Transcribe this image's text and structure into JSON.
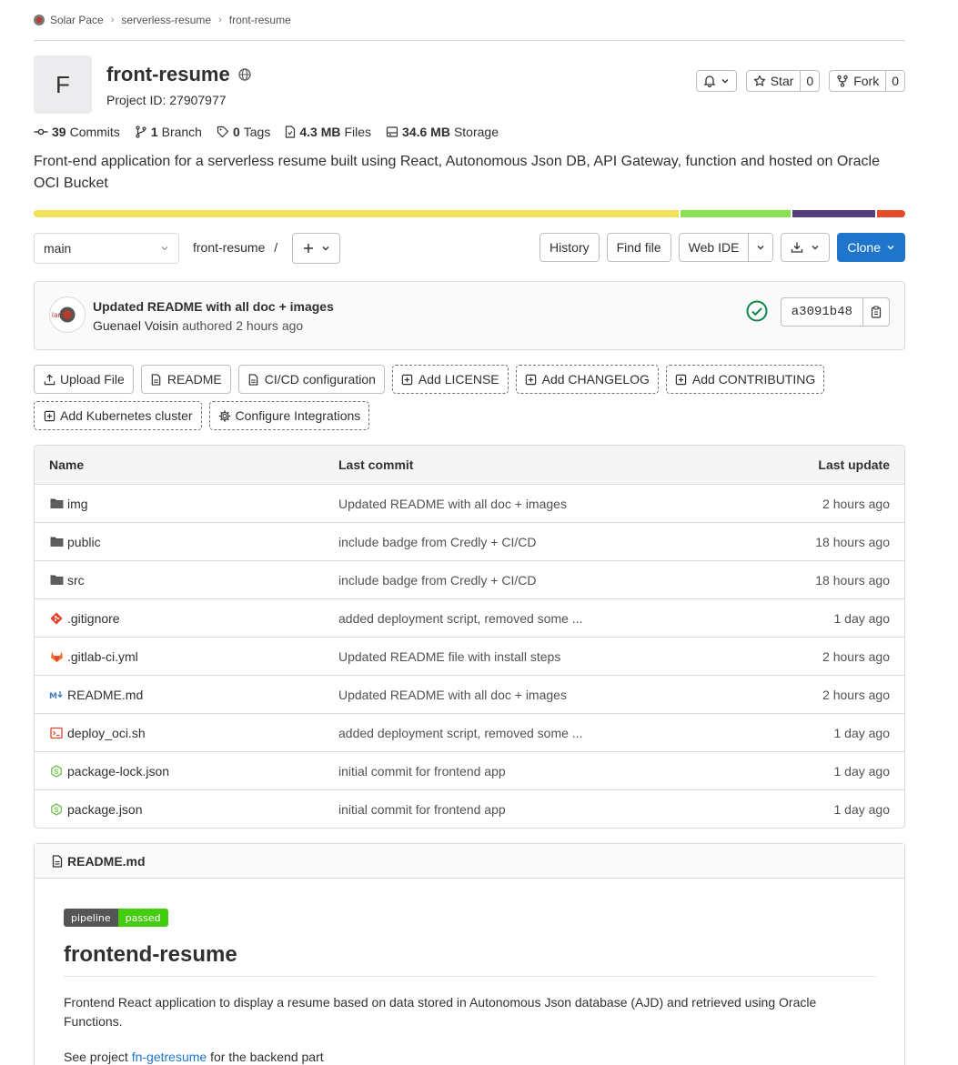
{
  "breadcrumb": [
    "Solar Pace",
    "serverless-resume",
    "front-resume"
  ],
  "project": {
    "avatar_letter": "F",
    "name": "front-resume",
    "id_label": "Project ID: 27907977",
    "star_label": "Star",
    "star_count": "0",
    "fork_label": "Fork",
    "fork_count": "0"
  },
  "stats": {
    "commits_count": "39",
    "commits_label": "Commits",
    "branch_count": "1",
    "branch_label": "Branch",
    "tags_count": "0",
    "tags_label": "Tags",
    "files_size": "4.3 MB",
    "files_label": "Files",
    "storage_size": "34.6 MB",
    "storage_label": "Storage"
  },
  "description": "Front-end application for a serverless resume built using React, Autonomous Json DB, API Gateway, function and hosted on Oracle OCI Bucket",
  "languages": [
    {
      "color": "#f1e05a",
      "percent": 74.5
    },
    {
      "color": "#89e051",
      "percent": 12.7
    },
    {
      "color": "#563d7c",
      "percent": 9.5
    },
    {
      "color": "#e34c26",
      "percent": 3.3
    }
  ],
  "nav": {
    "branch": "main",
    "path": "front-resume",
    "path_sep": "/",
    "history": "History",
    "find_file": "Find file",
    "web_ide": "Web IDE",
    "clone": "Clone"
  },
  "last_commit": {
    "title": "Updated README with all doc + images",
    "author": "Guenael Voisin",
    "authored": "authored 2 hours ago",
    "sha": "a3091b48",
    "avatar_text": "lar pa"
  },
  "quick_actions": [
    {
      "label": "Upload File",
      "icon": "upload-icon",
      "dashed": false
    },
    {
      "label": "README",
      "icon": "doc-icon",
      "dashed": false
    },
    {
      "label": "CI/CD configuration",
      "icon": "doc-icon",
      "dashed": false
    },
    {
      "label": "Add LICENSE",
      "icon": "plus-square-icon",
      "dashed": true
    },
    {
      "label": "Add CHANGELOG",
      "icon": "plus-square-icon",
      "dashed": true
    },
    {
      "label": "Add CONTRIBUTING",
      "icon": "plus-square-icon",
      "dashed": true
    },
    {
      "label": "Add Kubernetes cluster",
      "icon": "plus-square-icon",
      "dashed": true
    },
    {
      "label": "Configure Integrations",
      "icon": "gear-icon",
      "dashed": true
    }
  ],
  "file_table": {
    "headers": {
      "name": "Name",
      "last_commit": "Last commit",
      "last_update": "Last update"
    },
    "rows": [
      {
        "name": "img",
        "icon": "folder",
        "commit": "Updated README with all doc + images",
        "update": "2 hours ago"
      },
      {
        "name": "public",
        "icon": "folder",
        "commit": "include badge from Credly + CI/CD",
        "update": "18 hours ago"
      },
      {
        "name": "src",
        "icon": "folder",
        "commit": "include badge from Credly + CI/CD",
        "update": "18 hours ago"
      },
      {
        "name": ".gitignore",
        "icon": "git",
        "commit": "added deployment script, removed some ...",
        "update": "1 day ago"
      },
      {
        "name": ".gitlab-ci.yml",
        "icon": "gitlab",
        "commit": "Updated README file with install steps",
        "update": "2 hours ago"
      },
      {
        "name": "README.md",
        "icon": "markdown",
        "commit": "Updated README with all doc + images",
        "update": "2 hours ago"
      },
      {
        "name": "deploy_oci.sh",
        "icon": "shell",
        "commit": "added deployment script, removed some ...",
        "update": "1 day ago"
      },
      {
        "name": "package-lock.json",
        "icon": "node",
        "commit": "initial commit for frontend app",
        "update": "1 day ago"
      },
      {
        "name": "package.json",
        "icon": "node",
        "commit": "initial commit for frontend app",
        "update": "1 day ago"
      }
    ]
  },
  "readme": {
    "filename": "README.md",
    "badge_left": "pipeline",
    "badge_right": "passed",
    "heading": "frontend-resume",
    "paragraph": "Frontend React application to display a resume based on data stored in Autonomous Json database (AJD) and retrieved using Oracle Functions.",
    "see_prefix": "See project ",
    "see_link": "fn-getresume",
    "see_suffix": " for the backend part"
  },
  "colors": {
    "primary": "#1f75cb",
    "success": "#108548",
    "folder": "#525252"
  }
}
